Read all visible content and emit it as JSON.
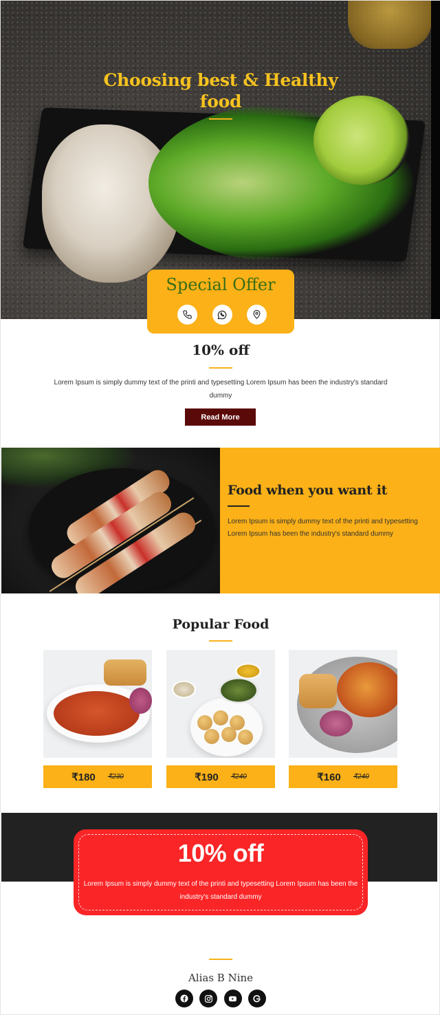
{
  "hero": {
    "title": "Choosing best & Healthy food"
  },
  "offer": {
    "title": "Special Offer",
    "icons": [
      "phone-icon",
      "whatsapp-icon",
      "location-pin-icon"
    ]
  },
  "discount": {
    "title": "10% off",
    "text": "Lorem Ipsum is simply dummy text of the printi and typesetting Lorem Ipsum has been the industry's standard dummy",
    "button_label": "Read More"
  },
  "feature": {
    "title": "Food when you want it",
    "text": "Lorem Ipsum is simply dummy text of the printi and typesetting Lorem Ipsum has been the industry's standard dummy"
  },
  "popular": {
    "title": "Popular Food",
    "items": [
      {
        "price": "₹180",
        "old_price": "₹230"
      },
      {
        "price": "₹190",
        "old_price": "₹240"
      },
      {
        "price": "₹160",
        "old_price": "₹240"
      }
    ]
  },
  "promo": {
    "title": "10% off",
    "text": "Lorem Ipsum is simply dummy text of the printi and typesetting Lorem Ipsum has been the industry's standard dummy"
  },
  "footer": {
    "name": "Alias B Nine",
    "socials": [
      "facebook-icon",
      "instagram-icon",
      "youtube-icon",
      "google-icon"
    ]
  },
  "colors": {
    "accent_yellow": "#fbb117",
    "title_yellow": "#f6c21f",
    "offer_green": "#3a6d17",
    "button_maroon": "#5b0a0a",
    "promo_red": "#fa2527",
    "dark_band": "#222222"
  }
}
